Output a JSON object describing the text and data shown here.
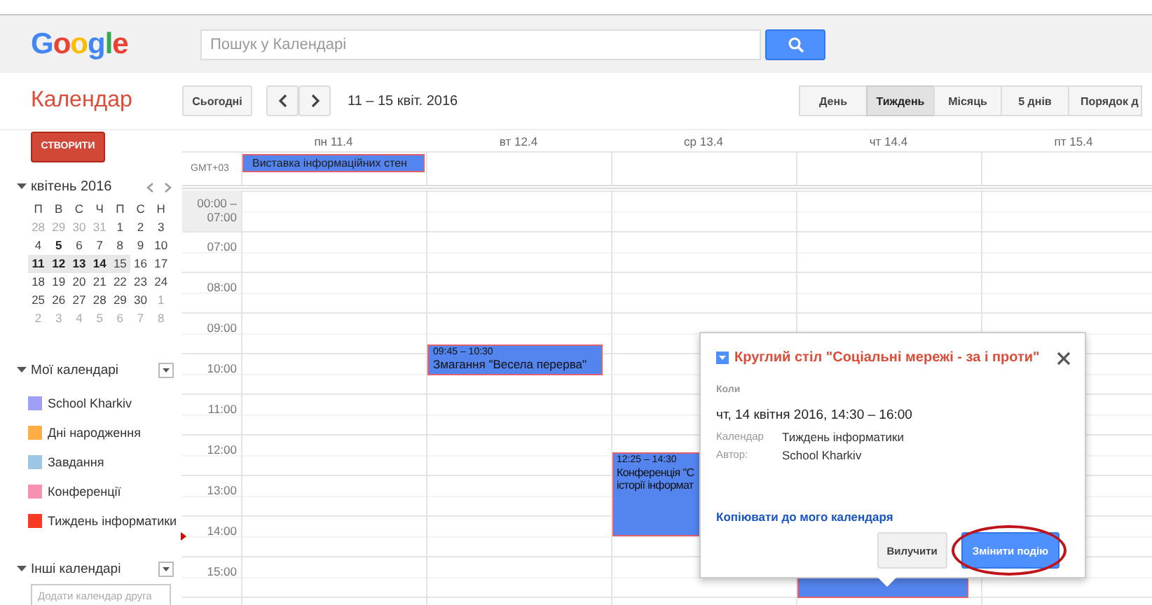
{
  "header": {
    "logo": "Google",
    "search": {
      "placeholder": "Пошук у Календарі"
    }
  },
  "toolbar": {
    "app_title": "Календар",
    "today_button": "Сьогодні",
    "date_range": "11 – 15 квіт. 2016",
    "views": [
      {
        "label": "День",
        "selected": false
      },
      {
        "label": "Тиждень",
        "selected": true
      },
      {
        "label": "Місяць",
        "selected": false
      },
      {
        "label": "5 днів",
        "selected": false
      },
      {
        "label": "Порядок д",
        "selected": false
      }
    ]
  },
  "create_button": "СТВОРИТИ",
  "mini_calendar": {
    "title": "квітень 2016",
    "weekdays": [
      "П",
      "В",
      "С",
      "Ч",
      "П",
      "С",
      "Н"
    ],
    "weeks": [
      [
        {
          "d": "28",
          "muted": true,
          "bold": false,
          "selected": false
        },
        {
          "d": "29",
          "muted": true,
          "bold": false,
          "selected": false
        },
        {
          "d": "30",
          "muted": true,
          "bold": false,
          "selected": false
        },
        {
          "d": "31",
          "muted": true,
          "bold": false,
          "selected": false
        },
        {
          "d": "1",
          "muted": false,
          "bold": false,
          "selected": false
        },
        {
          "d": "2",
          "muted": false,
          "bold": false,
          "selected": false
        },
        {
          "d": "3",
          "muted": false,
          "bold": false,
          "selected": false
        }
      ],
      [
        {
          "d": "4",
          "muted": false,
          "bold": false,
          "selected": false
        },
        {
          "d": "5",
          "muted": false,
          "bold": true,
          "selected": false
        },
        {
          "d": "6",
          "muted": false,
          "bold": false,
          "selected": false
        },
        {
          "d": "7",
          "muted": false,
          "bold": false,
          "selected": false
        },
        {
          "d": "8",
          "muted": false,
          "bold": false,
          "selected": false
        },
        {
          "d": "9",
          "muted": false,
          "bold": false,
          "selected": false
        },
        {
          "d": "10",
          "muted": false,
          "bold": false,
          "selected": false
        }
      ],
      [
        {
          "d": "11",
          "muted": false,
          "bold": true,
          "selected": true
        },
        {
          "d": "12",
          "muted": false,
          "bold": true,
          "selected": true
        },
        {
          "d": "13",
          "muted": false,
          "bold": true,
          "selected": true
        },
        {
          "d": "14",
          "muted": false,
          "bold": true,
          "selected": true
        },
        {
          "d": "15",
          "muted": false,
          "bold": false,
          "selected": true
        },
        {
          "d": "16",
          "muted": false,
          "bold": false,
          "selected": false
        },
        {
          "d": "17",
          "muted": false,
          "bold": false,
          "selected": false
        }
      ],
      [
        {
          "d": "18",
          "muted": false,
          "bold": false,
          "selected": false
        },
        {
          "d": "19",
          "muted": false,
          "bold": false,
          "selected": false
        },
        {
          "d": "20",
          "muted": false,
          "bold": false,
          "selected": false
        },
        {
          "d": "21",
          "muted": false,
          "bold": false,
          "selected": false
        },
        {
          "d": "22",
          "muted": false,
          "bold": false,
          "selected": false
        },
        {
          "d": "23",
          "muted": false,
          "bold": false,
          "selected": false
        },
        {
          "d": "24",
          "muted": false,
          "bold": false,
          "selected": false
        }
      ],
      [
        {
          "d": "25",
          "muted": false,
          "bold": false,
          "selected": false
        },
        {
          "d": "26",
          "muted": false,
          "bold": false,
          "selected": false
        },
        {
          "d": "27",
          "muted": false,
          "bold": false,
          "selected": false
        },
        {
          "d": "28",
          "muted": false,
          "bold": false,
          "selected": false
        },
        {
          "d": "29",
          "muted": false,
          "bold": false,
          "selected": false
        },
        {
          "d": "30",
          "muted": false,
          "bold": false,
          "selected": false
        },
        {
          "d": "1",
          "muted": true,
          "bold": false,
          "selected": false
        }
      ],
      [
        {
          "d": "2",
          "muted": true,
          "bold": false,
          "selected": false
        },
        {
          "d": "3",
          "muted": true,
          "bold": false,
          "selected": false
        },
        {
          "d": "4",
          "muted": true,
          "bold": false,
          "selected": false
        },
        {
          "d": "5",
          "muted": true,
          "bold": false,
          "selected": false
        },
        {
          "d": "6",
          "muted": true,
          "bold": false,
          "selected": false
        },
        {
          "d": "7",
          "muted": true,
          "bold": false,
          "selected": false
        },
        {
          "d": "8",
          "muted": true,
          "bold": false,
          "selected": false
        }
      ]
    ]
  },
  "my_calendars": {
    "title": "Мої календарі",
    "items": [
      {
        "name": "School Kharkiv",
        "color": "#9fa0f5"
      },
      {
        "name": "Дні народження",
        "color": "#ffad46"
      },
      {
        "name": "Завдання",
        "color": "#9fc6e7"
      },
      {
        "name": "Конференції",
        "color": "#f691b2"
      },
      {
        "name": "Тиждень інформатики",
        "color": "#f83a22"
      }
    ]
  },
  "other_calendars": {
    "title": "Інші календарі",
    "field": {
      "placeholder": "Додати календар друга"
    }
  },
  "grid": {
    "timezone": "GMT+03",
    "hours": [
      "00:00 –\n07:00",
      "07:00",
      "08:00",
      "09:00",
      "10:00",
      "11:00",
      "12:00",
      "13:00",
      "14:00",
      "15:00"
    ],
    "days": [
      {
        "label": "пн 11.4",
        "all_day": [
          {
            "title": "Виставка інформаційних стен"
          }
        ]
      },
      {
        "label": "вт 12.4",
        "events": [
          {
            "time": "09:45 – 10:30",
            "lines": [
              "Змагання \"Весела перерва\""
            ]
          }
        ]
      },
      {
        "label": "ср 13.4",
        "events": [
          {
            "time": "12:25 – 14:30",
            "lines": [
              "Конференція \"С",
              "історії інформат"
            ]
          }
        ]
      },
      {
        "label": "чт 14.4"
      },
      {
        "label": "пт 15.4"
      }
    ]
  },
  "popup": {
    "title": "Круглий стіл \"Соціальні мережі - за і проти\"",
    "when_label": "Коли",
    "when": "чт, 14 квітня 2016, 14:30 – 16:00",
    "details": [
      {
        "label": "Календар",
        "value": "Тиждень інформатики"
      },
      {
        "label": "Автор:",
        "value": "School Kharkiv"
      }
    ],
    "copy_link": "Копіювати до мого календаря",
    "buttons": [
      {
        "label": "Вилучити",
        "kind": "secondary",
        "highlighted": false
      },
      {
        "label": "Змінити подію",
        "kind": "primary",
        "highlighted": true
      }
    ]
  }
}
